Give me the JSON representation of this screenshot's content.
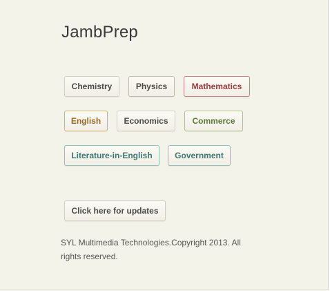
{
  "app": {
    "title": "JambPrep"
  },
  "subjects": [
    {
      "label": "Chemistry"
    },
    {
      "label": "Physics"
    },
    {
      "label": "Mathematics"
    },
    {
      "label": "English"
    },
    {
      "label": "Economics"
    },
    {
      "label": "Commerce"
    },
    {
      "label": "Literature-in-English"
    },
    {
      "label": "Government"
    }
  ],
  "updates": {
    "label": "Click here for updates"
  },
  "footer": {
    "text": "SYL Multimedia Technologies.Copyright 2013. All rights reserved."
  },
  "colors": {
    "page_background": "#f4f3e9",
    "mathematics": "#9a3b3b",
    "english": "#9a6a26",
    "commerce": "#5b7a3a",
    "literature_government": "#3c7773"
  }
}
